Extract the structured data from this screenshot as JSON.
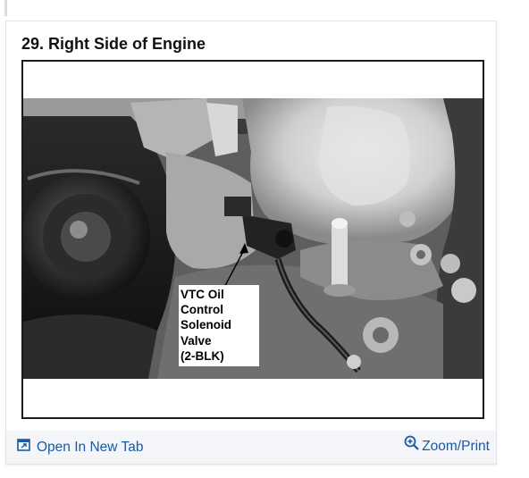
{
  "figure": {
    "title": "29. Right Side of Engine",
    "image_alt": "Photograph of the right side of an engine",
    "callout": "VTC Oil\nControl\nSolenoid\nValve\n(2-BLK)"
  },
  "footer": {
    "open_label": "Open In New Tab",
    "zoom_label": "Zoom/Print",
    "open_icon": "open-in-new-tab-icon",
    "zoom_icon": "magnifier-plus-icon"
  },
  "colors": {
    "link": "#1a5aa6",
    "footer_bg": "#f3f5f9",
    "card_border": "#e4e4e4"
  }
}
